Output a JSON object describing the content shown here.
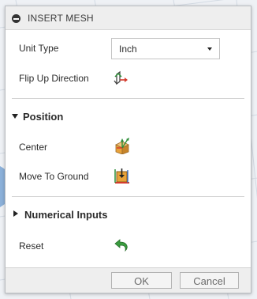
{
  "dialog": {
    "title": "INSERT MESH"
  },
  "fields": {
    "unit_type_label": "Unit Type",
    "unit_type_value": "Inch",
    "flip_up_label": "Flip Up Direction"
  },
  "position": {
    "header": "Position",
    "center_label": "Center",
    "move_to_ground_label": "Move To Ground"
  },
  "numerical": {
    "header": "Numerical Inputs",
    "reset_label": "Reset"
  },
  "footer": {
    "ok_label": "OK",
    "cancel_label": "Cancel"
  },
  "colors": {
    "accent_green": "#2f8f3a",
    "accent_red": "#d33a2c",
    "accent_orange": "#e8a23a"
  }
}
